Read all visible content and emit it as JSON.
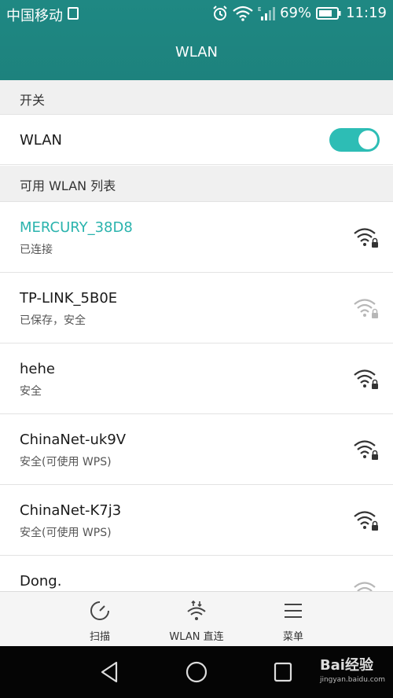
{
  "status_bar": {
    "carrier": "中国移动",
    "battery": "69%",
    "time": "11:19"
  },
  "header": {
    "title": "WLAN"
  },
  "section_switch": {
    "label": "开关"
  },
  "wlan_switch": {
    "label": "WLAN",
    "enabled": true
  },
  "section_networks": {
    "label": "可用 WLAN 列表"
  },
  "networks": [
    {
      "name": "MERCURY_38D8",
      "status": "已连接",
      "signal": "strong-lock"
    },
    {
      "name": "TP-LINK_5B0E",
      "status": "已保存，安全",
      "signal": "weak-lock"
    },
    {
      "name": "hehe",
      "status": "安全",
      "signal": "strong-lock"
    },
    {
      "name": "ChinaNet-uk9V",
      "status": "安全(可使用 WPS)",
      "signal": "strong-lock"
    },
    {
      "name": "ChinaNet-K7j3",
      "status": "安全(可使用 WPS)",
      "signal": "strong-lock"
    },
    {
      "name": "Dong.",
      "status": "",
      "signal": "weak-lock"
    }
  ],
  "toolbar": {
    "scan_label": "扫描",
    "direct_label": "WLAN 直连",
    "menu_label": "菜单"
  },
  "watermark": {
    "brand": "Bai经验",
    "url": "jingyan.baidu.com"
  },
  "colors": {
    "accent": "#2dbdb5",
    "header": "#1e8681",
    "connected_text": "#2ab3ad"
  }
}
